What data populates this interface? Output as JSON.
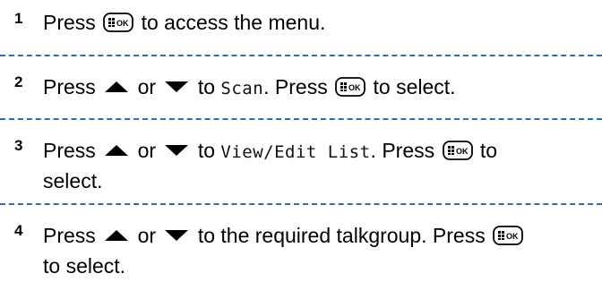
{
  "steps": [
    {
      "number": "1",
      "before": "Press",
      "after": "to access the menu."
    },
    {
      "number": "2",
      "press": "Press",
      "or": "or",
      "to": "to",
      "target": "Scan",
      "press2": ". Press",
      "after": "to select."
    },
    {
      "number": "3",
      "press": "Press",
      "or": "or",
      "to": "to",
      "target": "View/Edit List",
      "press2": ". Press",
      "after": "to",
      "line2": "select."
    },
    {
      "number": "4",
      "press": "Press",
      "or": "or",
      "to": "to the required talkgroup. Press",
      "line2": "to select."
    }
  ],
  "icons": {
    "menu_ok_key": "menu-ok-button-icon",
    "up_arrow": "up-arrow-icon",
    "down_arrow": "down-arrow-icon"
  },
  "colors": {
    "separator": "#2f6fb0",
    "text": "#000000"
  },
  "key_label": "OK"
}
